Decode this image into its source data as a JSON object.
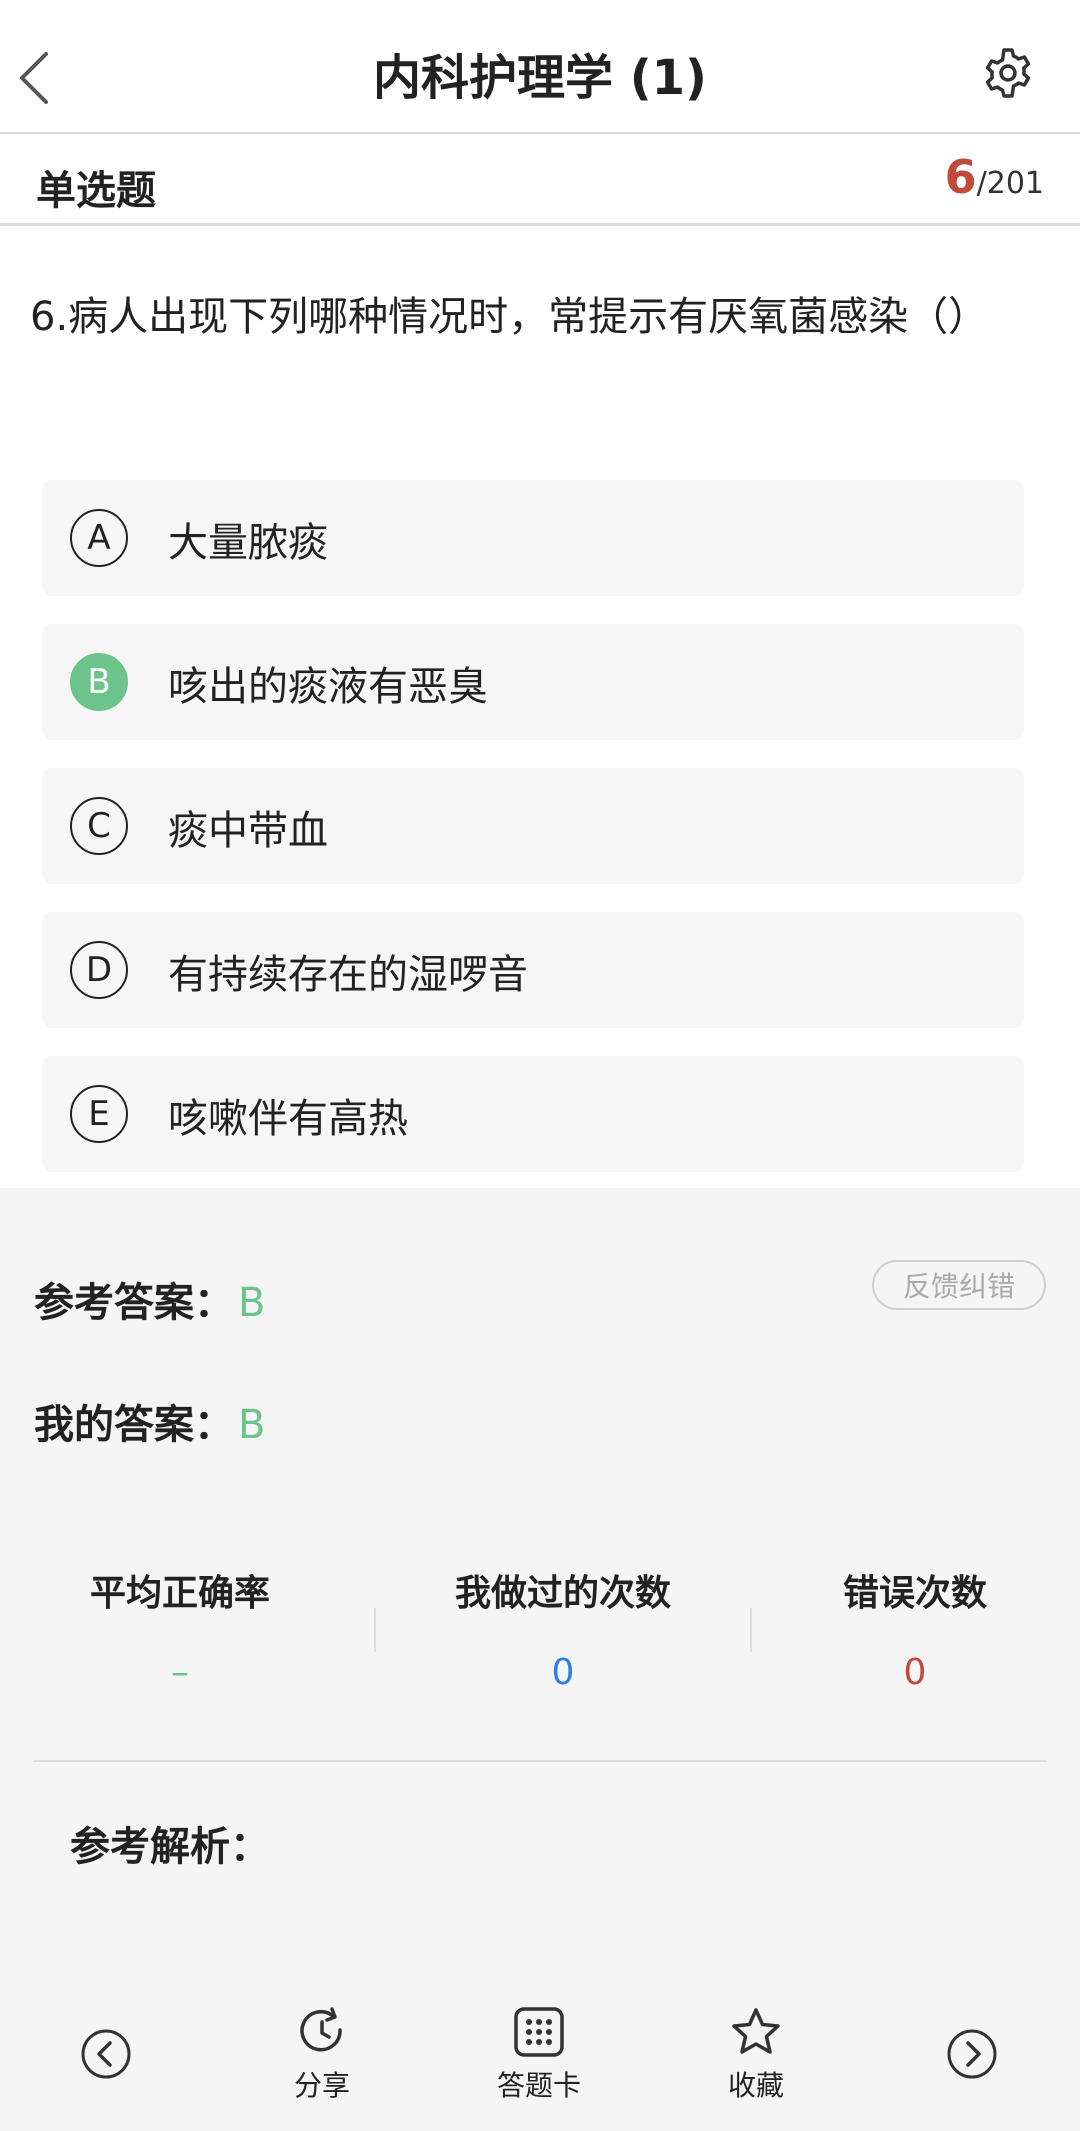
{
  "header": {
    "title": "内科护理学 (1)"
  },
  "question_bar": {
    "type_label": "单选题",
    "current": "6",
    "total": "/201"
  },
  "question": {
    "text": "6.病人出现下列哪种情况时，常提示有厌氧菌感染（）"
  },
  "options": [
    {
      "letter": "A",
      "text": "大量脓痰",
      "state": "normal"
    },
    {
      "letter": "B",
      "text": "咳出的痰液有恶臭",
      "state": "correct"
    },
    {
      "letter": "C",
      "text": "痰中带血",
      "state": "normal"
    },
    {
      "letter": "D",
      "text": "有持续存在的湿啰音",
      "state": "normal"
    },
    {
      "letter": "E",
      "text": "咳嗽伴有高热",
      "state": "normal"
    }
  ],
  "analysis": {
    "reference_label": "参考答案：",
    "reference_value": "B",
    "my_label": "我的答案：",
    "my_value": "B",
    "feedback_label": "反馈纠错",
    "stats": [
      {
        "label": "平均正确率",
        "value": "–"
      },
      {
        "label": "我做过的次数",
        "value": "0"
      },
      {
        "label": "错误次数",
        "value": "0"
      }
    ],
    "explanation_label": "参考解析："
  },
  "toolbar": {
    "share_label": "分享",
    "card_label": "答题卡",
    "favorite_label": "收藏"
  },
  "colors": {
    "correct": "#6cc48a",
    "count_blue": "#2f80e8",
    "error_red": "#c24a3c"
  }
}
